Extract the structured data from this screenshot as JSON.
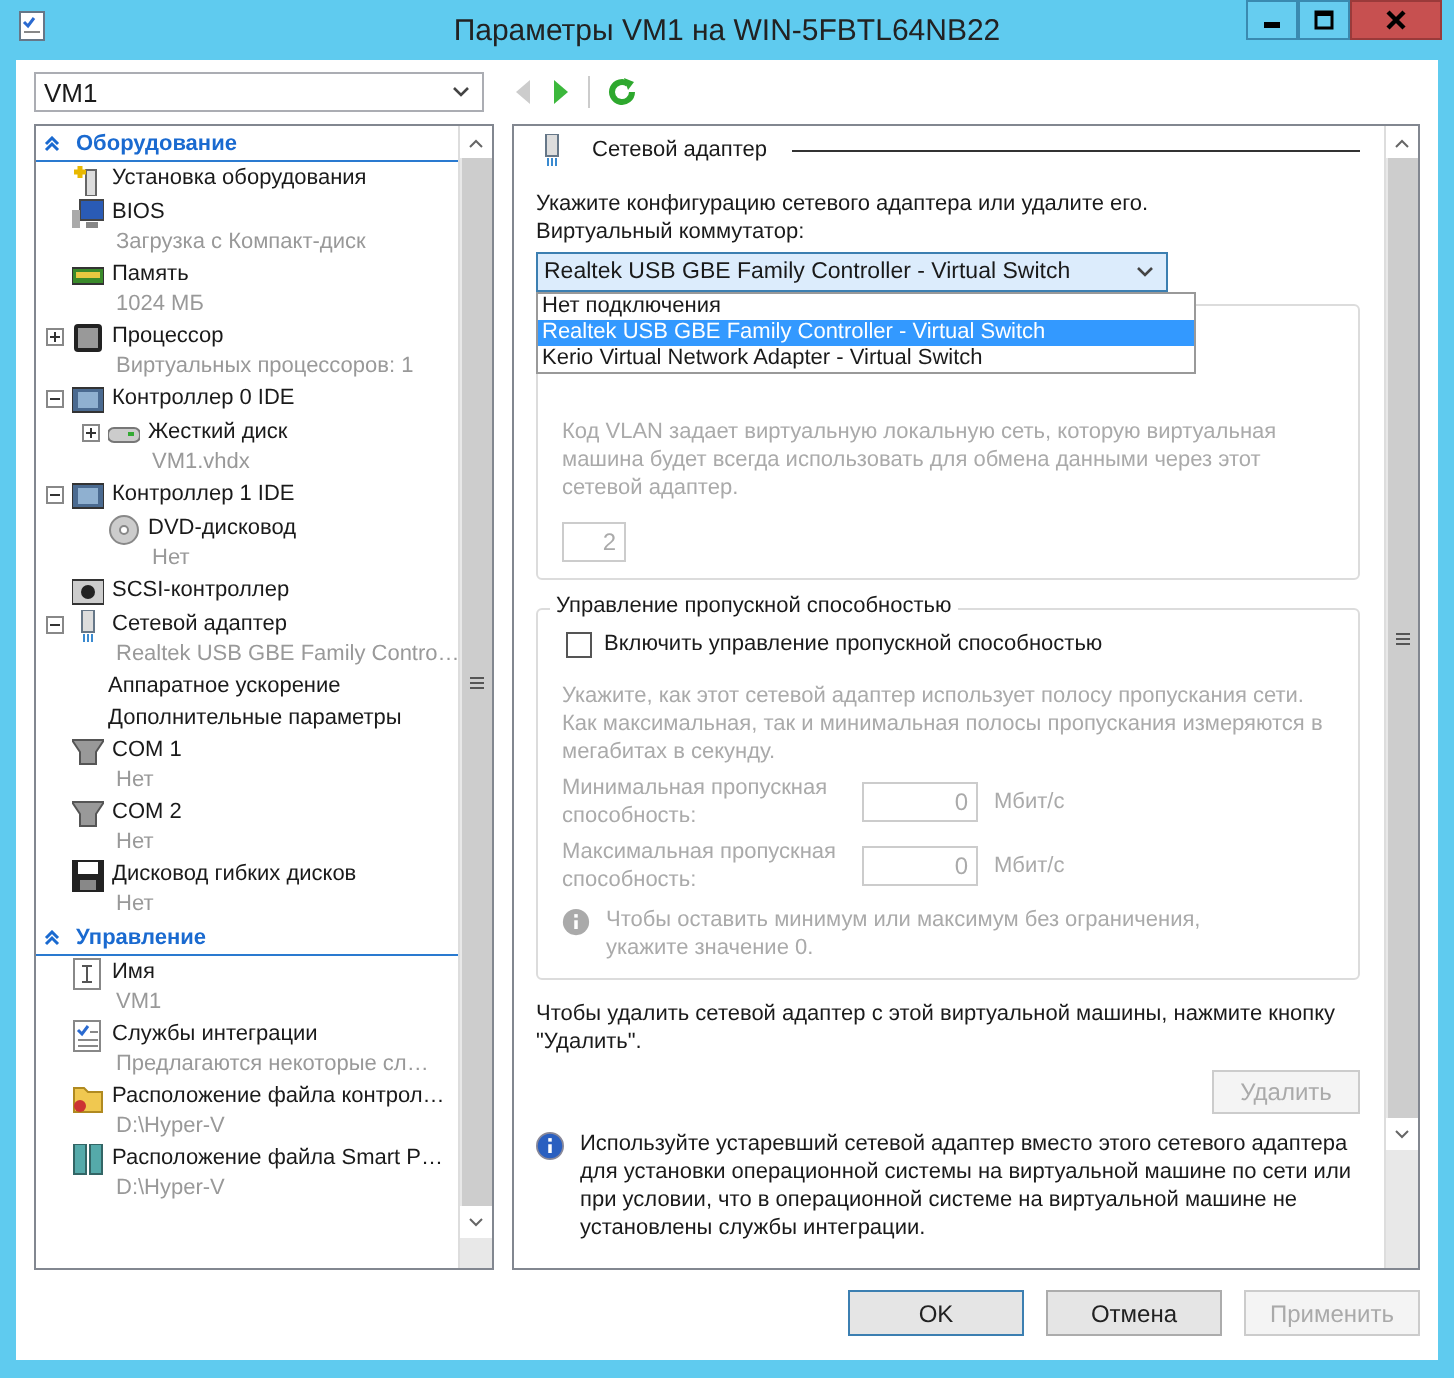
{
  "window": {
    "title": "Параметры VM1 на WIN-5FBTL64NB22"
  },
  "toolbar": {
    "vm_select": "VM1",
    "nav": [
      {
        "kind": "back",
        "disabled": true
      },
      {
        "kind": "forward",
        "disabled": false
      },
      {
        "kind": "refresh",
        "disabled": false
      }
    ]
  },
  "sidebar": {
    "sections": [
      {
        "title": "Оборудование",
        "expanded": true,
        "items": [
          {
            "kind": "add-hardware",
            "label": "Установка оборудования"
          },
          {
            "kind": "bios",
            "label": "BIOS",
            "detail": "Загрузка с Компакт-диск"
          },
          {
            "kind": "memory",
            "label": "Память",
            "detail": "1024 МБ"
          },
          {
            "kind": "processor",
            "label": "Процессор",
            "detail": "Виртуальных процессоров: 1",
            "expanded": false
          },
          {
            "kind": "controller",
            "label": "Контроллер 0 IDE",
            "expanded": true,
            "children": [
              {
                "kind": "disk",
                "label": "Жесткий диск",
                "detail": "VM1.vhdx",
                "expanded": false
              }
            ]
          },
          {
            "kind": "controller",
            "label": "Контроллер 1 IDE",
            "expanded": true,
            "children": [
              {
                "kind": "dvd",
                "label": "DVD-дисковод",
                "detail": "Нет"
              }
            ]
          },
          {
            "kind": "scsi",
            "label": "SCSI-контроллер"
          },
          {
            "kind": "network",
            "label": "Сетевой адаптер",
            "detail": "Realtek USB GBE Family Contro…",
            "expanded": true,
            "children": [
              {
                "kind": "setting",
                "label": "Аппаратное ускорение"
              },
              {
                "kind": "setting",
                "label": "Дополнительные параметры"
              }
            ]
          },
          {
            "kind": "com",
            "label": "COM 1",
            "detail": "Нет"
          },
          {
            "kind": "com",
            "label": "COM 2",
            "detail": "Нет"
          },
          {
            "kind": "floppy",
            "label": "Дисковод гибких дисков",
            "detail": "Нет"
          }
        ]
      },
      {
        "title": "Управление",
        "expanded": true,
        "items": [
          {
            "kind": "name",
            "label": "Имя",
            "detail": "VM1"
          },
          {
            "kind": "integration",
            "label": "Службы интеграции",
            "detail": "Предлагаются некоторые сл…"
          },
          {
            "kind": "folder",
            "label": "Расположение файла контрол…",
            "detail": "D:\\Hyper-V"
          },
          {
            "kind": "storage",
            "label": "Расположение файла Smart P…",
            "detail": "D:\\Hyper-V"
          }
        ]
      }
    ]
  },
  "panel": {
    "title": "Сетевой адаптер",
    "intro": "Укажите конфигурацию сетевого адаптера или удалите его.",
    "switch_label": "Виртуальный коммутатор:",
    "switch": {
      "value": "Realtek USB GBE Family Controller - Virtual Switch",
      "open": true,
      "options": [
        {
          "label": "Нет подключения",
          "selected": false
        },
        {
          "label": "Realtek USB GBE Family Controller - Virtual Switch",
          "selected": true
        },
        {
          "label": "Kerio Virtual Network Adapter - Virtual Switch",
          "selected": false
        }
      ]
    },
    "vlan": {
      "description": "Код VLAN задает виртуальную локальную сеть, которую виртуальная машина будет всегда использовать для обмена данными через этот сетевой адаптер.",
      "value": "2",
      "disabled": true
    },
    "bandwidth": {
      "title": "Управление пропускной способностью",
      "checkbox": {
        "label": "Включить управление пропускной способностью",
        "checked": false
      },
      "description": "Укажите, как этот сетевой адаптер использует полосу пропускания сети. Как максимальная, так и минимальная полосы пропускания измеряются в мегабитах в секунду.",
      "rows": [
        {
          "label": "Минимальная пропускная способность:",
          "value": "0",
          "unit": "Мбит/с"
        },
        {
          "label": "Максимальная пропускная способность:",
          "value": "0",
          "unit": "Мбит/с"
        }
      ],
      "note": "Чтобы оставить минимум или максимум без ограничения, укажите значение 0."
    },
    "remove_text": "Чтобы удалить сетевой адаптер с этой виртуальной машины, нажмите кнопку \"Удалить\".",
    "remove_button": {
      "label": "Удалить",
      "disabled": true
    },
    "legacy_note": "Используйте устаревший сетевой адаптер вместо этого сетевого адаптера для установки операционной системы на виртуальной машине по сети или при условии, что в операционной системе на виртуальной машине не установлены службы интеграции."
  },
  "buttons": [
    {
      "label": "OK",
      "kind": "default",
      "disabled": false
    },
    {
      "label": "Отмена",
      "kind": "normal",
      "disabled": false
    },
    {
      "label": "Применить",
      "kind": "normal",
      "disabled": true
    }
  ]
}
